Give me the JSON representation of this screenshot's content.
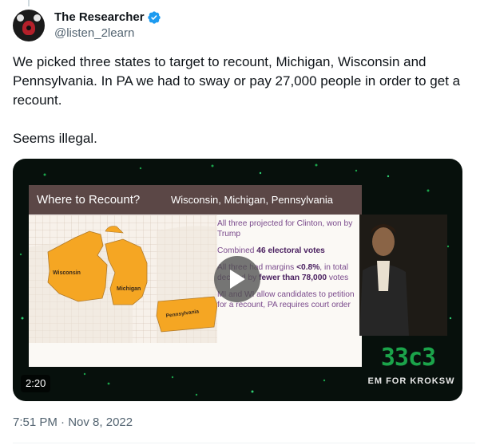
{
  "author": {
    "display_name": "The Researcher",
    "handle": "@listen_2learn",
    "verified_color": "#1d9bf0"
  },
  "tweet": {
    "paragraph_1": "We picked three states to target to recount, Michigan, Wisconsin and Pennsylvania. In PA we had to sway or pay 27,000 people in order to get a recount.",
    "paragraph_2": "Seems illegal."
  },
  "media": {
    "duration": "2:20",
    "play_icon": "play-icon",
    "slide": {
      "title": "Where to Recount?",
      "subtitle": "Wisconsin, Michigan, Pennsylvania",
      "map_labels": {
        "wisconsin": "Wisconsin",
        "michigan": "Michigan",
        "pennsylvania": "Pennsylvania"
      },
      "point_1": "All three projected for Clinton, won by Trump",
      "point_2_prefix": "Combined ",
      "point_2_bold": "46 electoral votes",
      "point_3_prefix": "All three had margins ",
      "point_3_bold_1": "<0.8%",
      "point_3_mid": ", in total decided by ",
      "point_3_bold_2": "fewer than 78,000",
      "point_3_suffix": " votes",
      "point_4": "MI and WI allow candidates to petition for a recount, PA requires court order"
    },
    "conference_logo": "33c3",
    "conference_sub": "EM FOR KROKSW"
  },
  "timestamp": {
    "time": "7:51 PM",
    "separator": " · ",
    "date": "Nov 8, 2022"
  },
  "colors": {
    "accent": "#1d9bf0",
    "secondary_text": "#536471",
    "state_fill": "#f5a623"
  }
}
